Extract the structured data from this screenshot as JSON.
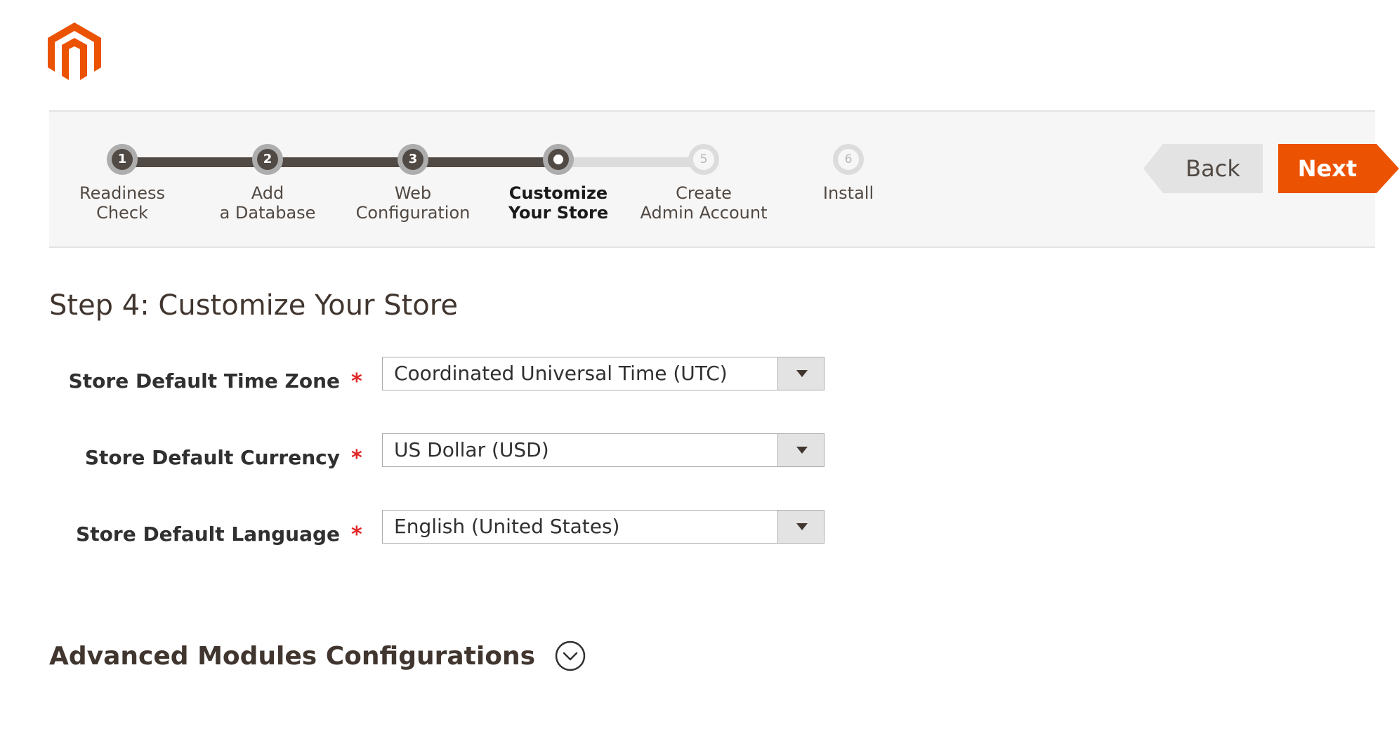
{
  "brand": {
    "logo": "magento-logo-icon",
    "accent_color": "#eb5202"
  },
  "wizard": {
    "steps": [
      {
        "number": "1",
        "line1": "Readiness",
        "line2": "Check",
        "state": "done"
      },
      {
        "number": "2",
        "line1": "Add",
        "line2": "a Database",
        "state": "done"
      },
      {
        "number": "3",
        "line1": "Web",
        "line2": "Configuration",
        "state": "done"
      },
      {
        "number": "4",
        "line1": "Customize",
        "line2": "Your Store",
        "state": "current"
      },
      {
        "number": "5",
        "line1": "Create",
        "line2": "Admin Account",
        "state": "todo"
      },
      {
        "number": "6",
        "line1": "Install",
        "line2": "",
        "state": "todo"
      }
    ],
    "back_label": "Back",
    "next_label": "Next"
  },
  "page": {
    "title": "Step 4: Customize Your Store"
  },
  "form": {
    "required_mark": "*",
    "timezone": {
      "label": "Store Default Time Zone",
      "value": "Coordinated Universal Time (UTC)"
    },
    "currency": {
      "label": "Store Default Currency",
      "value": "US Dollar (USD)"
    },
    "language": {
      "label": "Store Default Language",
      "value": "English (United States)"
    }
  },
  "advanced": {
    "title": "Advanced Modules Configurations",
    "icon": "chevron-down-circle-icon"
  }
}
